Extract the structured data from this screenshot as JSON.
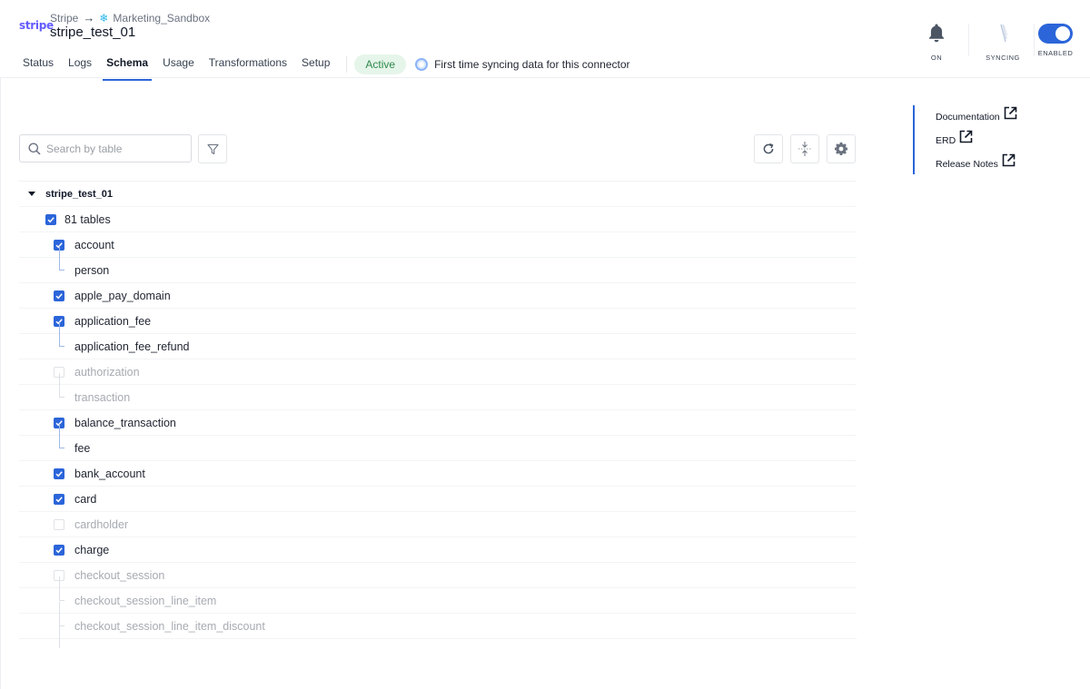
{
  "header": {
    "brand": "stripe",
    "breadcrumb": {
      "source": "Stripe",
      "arrow": "→",
      "destination": "Marketing_Sandbox"
    },
    "connector_name": "stripe_test_01",
    "tabs": [
      {
        "label": "Status"
      },
      {
        "label": "Logs"
      },
      {
        "label": "Schema",
        "active": true
      },
      {
        "label": "Usage"
      },
      {
        "label": "Transformations"
      },
      {
        "label": "Setup"
      }
    ],
    "status": "Active",
    "sync_note": "First time syncing data for this connector",
    "controls": {
      "notifications": "ON",
      "sync": "SYNCING",
      "enabled": "ENABLED"
    }
  },
  "toolbar": {
    "search_placeholder": "Search by table",
    "icons": [
      "filter-icon",
      "refresh-icon",
      "collapse-icon",
      "gear-icon"
    ]
  },
  "tree": {
    "schema": "stripe_test_01",
    "tables_count": "81 tables",
    "rows": [
      {
        "name": "account",
        "level": "parent",
        "checked": true,
        "disabled": false
      },
      {
        "name": "person",
        "level": "child",
        "checked": null,
        "disabled": false
      },
      {
        "name": "apple_pay_domain",
        "level": "parent",
        "checked": true,
        "disabled": false
      },
      {
        "name": "application_fee",
        "level": "parent",
        "checked": true,
        "disabled": false
      },
      {
        "name": "application_fee_refund",
        "level": "child",
        "checked": null,
        "disabled": false
      },
      {
        "name": "authorization",
        "level": "parent",
        "checked": false,
        "disabled": true
      },
      {
        "name": "transaction",
        "level": "child",
        "checked": null,
        "disabled": true
      },
      {
        "name": "balance_transaction",
        "level": "parent",
        "checked": true,
        "disabled": false
      },
      {
        "name": "fee",
        "level": "child",
        "checked": null,
        "disabled": false
      },
      {
        "name": "bank_account",
        "level": "parent",
        "checked": true,
        "disabled": false
      },
      {
        "name": "card",
        "level": "parent",
        "checked": true,
        "disabled": false
      },
      {
        "name": "cardholder",
        "level": "parent",
        "checked": false,
        "disabled": true
      },
      {
        "name": "charge",
        "level": "parent",
        "checked": true,
        "disabled": false
      },
      {
        "name": "checkout_session",
        "level": "parent",
        "checked": false,
        "disabled": true
      },
      {
        "name": "checkout_session_line_item",
        "level": "child",
        "checked": null,
        "disabled": true
      },
      {
        "name": "checkout_session_line_item_discount",
        "level": "child",
        "checked": null,
        "disabled": true
      }
    ]
  },
  "side_links": [
    {
      "label": "Documentation"
    },
    {
      "label": "ERD"
    },
    {
      "label": "Release Notes"
    }
  ],
  "colors": {
    "accent": "#2b65d9",
    "brand": "#635bff",
    "active_bg": "#e6f5ea",
    "active_text": "#2f8a4a",
    "snowflake": "#29b5e8"
  }
}
